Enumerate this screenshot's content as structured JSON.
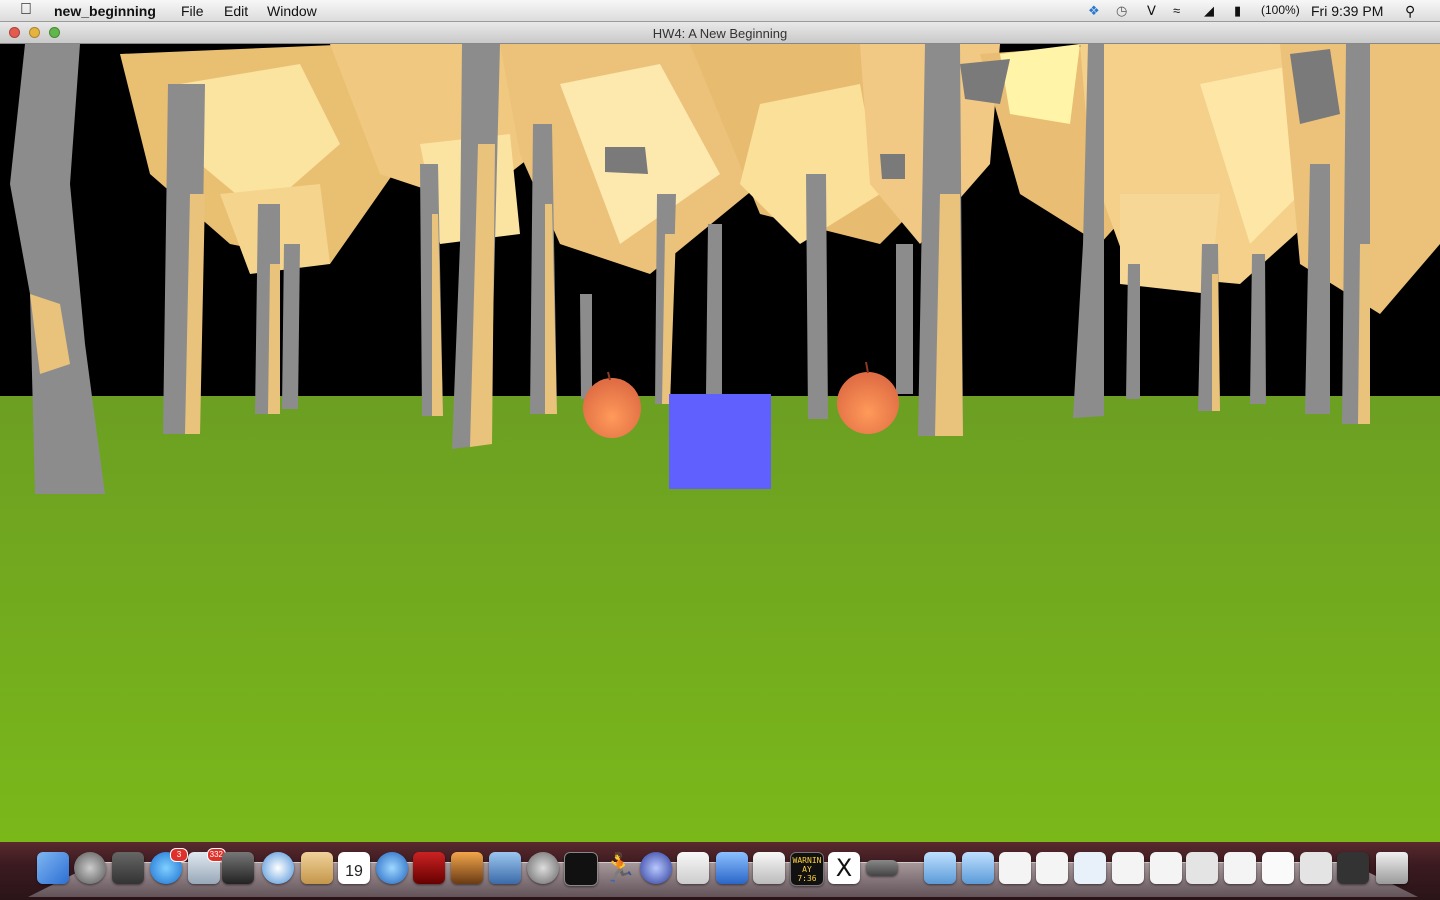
{
  "menubar": {
    "app_name": "new_beginning",
    "menus": [
      "File",
      "Edit",
      "Window"
    ],
    "battery": "(100%)",
    "clock": "Fri 9:39 PM"
  },
  "window": {
    "title": "HW4: A New Beginning"
  },
  "scene": {
    "sky_color": "#000000",
    "ground_color": "#78b01a",
    "cube_color": "#6060ff",
    "apple_color": "#f07a4a",
    "trunk_color": "#8e8e8e",
    "leaf_color": "#f7d48a"
  },
  "dock": {
    "app_store_badge": "3",
    "mail_badge": "332",
    "calendar_day": "19",
    "console_text": "WARNIN AY 7:36",
    "x11_label": "X"
  }
}
